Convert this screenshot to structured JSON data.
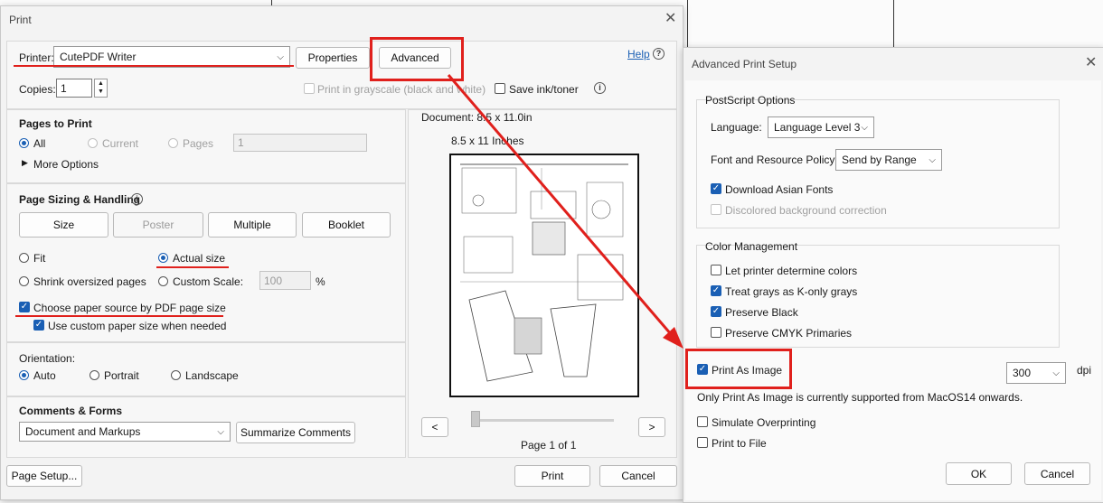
{
  "print_dialog": {
    "title": "Print",
    "printer_label": "Printer:",
    "printer_value": "CutePDF Writer",
    "properties_label": "Properties",
    "advanced_label": "Advanced",
    "help_label": "Help",
    "copies_label": "Copies:",
    "copies_value": "1",
    "grayscale_label": "Print in grayscale (black and white)",
    "save_ink_label": "Save ink/toner",
    "pages_to_print": {
      "heading": "Pages to Print",
      "all": "All",
      "current": "Current",
      "pages": "Pages",
      "pages_value": "1",
      "more_options": "More Options"
    },
    "page_sizing": {
      "heading": "Page Sizing & Handling",
      "tabs": [
        "Size",
        "Poster",
        "Multiple",
        "Booklet"
      ],
      "fit": "Fit",
      "actual_size": "Actual size",
      "shrink": "Shrink oversized pages",
      "custom_scale": "Custom Scale:",
      "scale_value": "100",
      "percent": "%",
      "choose_paper": "Choose paper source by PDF page size",
      "custom_paper": "Use custom paper size when needed"
    },
    "orientation": {
      "heading": "Orientation:",
      "auto": "Auto",
      "portrait": "Portrait",
      "landscape": "Landscape"
    },
    "comments": {
      "heading": "Comments & Forms",
      "value": "Document and Markups",
      "summarize": "Summarize Comments"
    },
    "preview": {
      "document_size": "Document: 8.5 x 11.0in",
      "paper_size": "8.5 x 11 Inches",
      "prev": "<",
      "next": ">",
      "page_info": "Page 1 of 1"
    },
    "page_setup_label": "Page Setup...",
    "print_label": "Print",
    "cancel_label": "Cancel"
  },
  "advanced_dialog": {
    "title": "Advanced Print Setup",
    "postscript": {
      "heading": "PostScript Options",
      "language_label": "Language:",
      "language_value": "Language Level 3",
      "font_policy_label": "Font and Resource Policy:",
      "font_policy_value": "Send by Range",
      "download_fonts": "Download Asian Fonts",
      "discolored": "Discolored background correction"
    },
    "color": {
      "heading": "Color Management",
      "let_printer": "Let printer determine colors",
      "treat_grays": "Treat grays as K-only grays",
      "preserve_black": "Preserve Black",
      "preserve_cmyk": "Preserve CMYK Primaries"
    },
    "print_as_image": "Print As Image",
    "dpi_value": "300",
    "dpi_label": "dpi",
    "macos_note": "Only Print As Image is currently supported from MacOS14 onwards.",
    "simulate": "Simulate Overprinting",
    "print_to_file": "Print to File",
    "ok_label": "OK",
    "cancel_label": "Cancel"
  },
  "colors": {
    "accent": "#1a5fb4",
    "annotation_red": "#e0201c"
  }
}
